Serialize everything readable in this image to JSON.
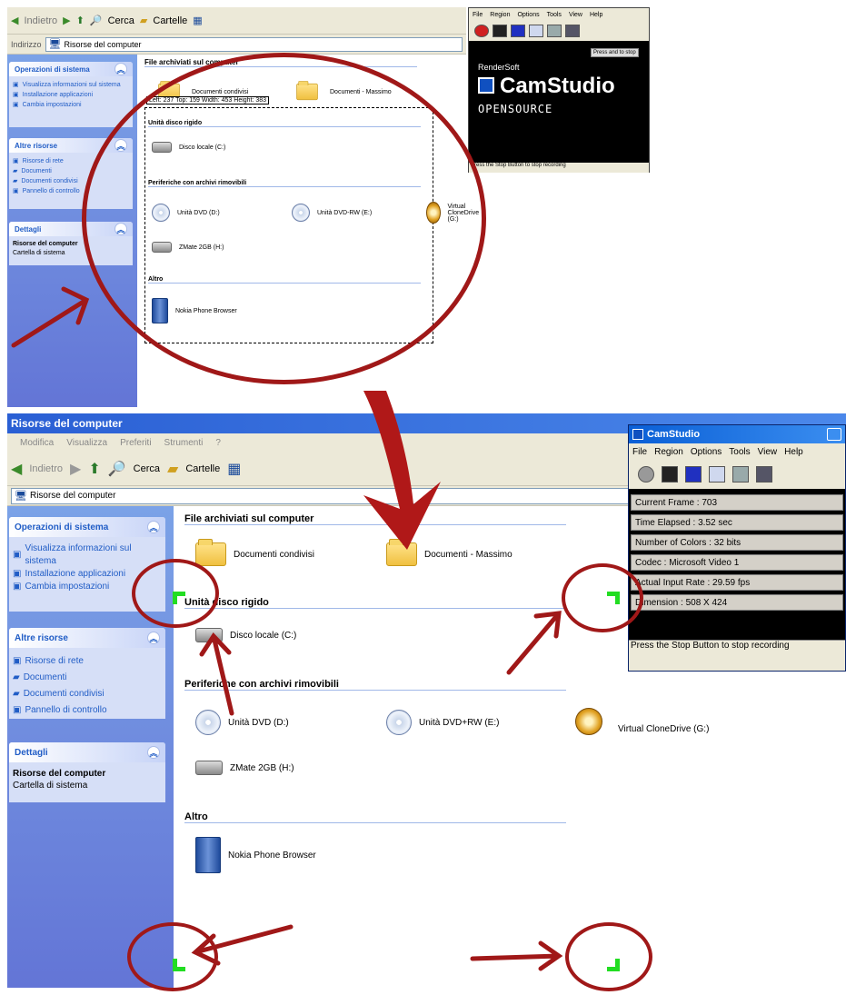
{
  "top": {
    "toolbar": {
      "back": "Indietro",
      "search": "Cerca",
      "folders": "Cartelle"
    },
    "address_label": "Indirizzo",
    "address_value": "Risorse del computer",
    "tasks_system": {
      "title": "Operazioni di sistema",
      "links": [
        "Visualizza informazioni sul sistema",
        "Installazione applicazioni",
        "Cambia impostazioni"
      ]
    },
    "other_places": {
      "title": "Altre risorse",
      "links": [
        "Risorse di rete",
        "Documenti",
        "Documenti condivisi",
        "Pannello di controllo"
      ]
    },
    "details": {
      "title": "Dettagli",
      "name": "Risorse del computer",
      "type": "Cartella di sistema"
    },
    "groups": {
      "files": "File archiviati sul computer",
      "hdd": "Unità disco rigido",
      "removable": "Periferiche con archivi rimovibili",
      "other": "Altro"
    },
    "items": {
      "shared_docs": "Documenti condivisi",
      "user_docs": "Documenti - Massimo",
      "local_disk": "Disco locale (C:)",
      "dvd": "Unità DVD (D:)",
      "dvdrw": "Unità DVD-RW (E:)",
      "clone": "Virtual CloneDrive (G:)",
      "zmate": "ZMate 2GB (H:)",
      "nokia": "Nokia Phone Browser"
    },
    "selection_info": "Left: 237  Top: 159  Width: 453  Height: 383",
    "camstudio": {
      "menu": [
        "File",
        "Region",
        "Options",
        "Tools",
        "View",
        "Help"
      ],
      "press_btn": "Press and to stop",
      "brand": "RenderSoft",
      "product": "CamStudio",
      "open_source": "OPENSOURCE",
      "status": "Press the Stop Button to stop recording"
    }
  },
  "bottom": {
    "window_title": "Risorse del computer",
    "menu": [
      "Modifica",
      "Visualizza",
      "Preferiti",
      "Strumenti",
      "?"
    ],
    "toolbar": {
      "back": "Indietro",
      "search": "Cerca",
      "folders": "Cartelle"
    },
    "address_value": "Risorse del computer",
    "tasks_system": {
      "title": "Operazioni di sistema",
      "links": [
        "Visualizza informazioni sul sistema",
        "Installazione applicazioni",
        "Cambia impostazioni"
      ]
    },
    "other_places": {
      "title": "Altre risorse",
      "links": [
        "Risorse di rete",
        "Documenti",
        "Documenti condivisi",
        "Pannello di controllo"
      ]
    },
    "details": {
      "title": "Dettagli",
      "name": "Risorse del computer",
      "type": "Cartella di sistema"
    },
    "groups": {
      "files": "File archiviati sul computer",
      "hdd": "Unità disco rigido",
      "removable": "Periferiche con archivi rimovibili",
      "other": "Altro"
    },
    "items": {
      "shared_docs": "Documenti condivisi",
      "user_docs": "Documenti - Massimo",
      "local_disk": "Disco locale (C:)",
      "dvd": "Unità DVD (D:)",
      "dvdrw": "Unità DVD+RW (E:)",
      "clone": "Virtual CloneDrive (G:)",
      "zmate": "ZMate 2GB (H:)",
      "nokia": "Nokia Phone Browser"
    },
    "camstudio": {
      "title": "CamStudio",
      "menu": [
        "File",
        "Region",
        "Options",
        "Tools",
        "View",
        "Help"
      ],
      "stats": [
        "Current Frame : 703",
        "Time Elapsed : 3.52 sec",
        "Number of Colors : 32 bits",
        "Codec : Microsoft Video 1",
        "Actual Input Rate : 29.59 fps",
        "Dimension : 508 X 424"
      ],
      "status": "Press the Stop Button to stop recording"
    }
  },
  "colors": {
    "xp_blue": "#6375d6",
    "annotation_red": "#a01818",
    "corner_green": "#22dd22"
  }
}
